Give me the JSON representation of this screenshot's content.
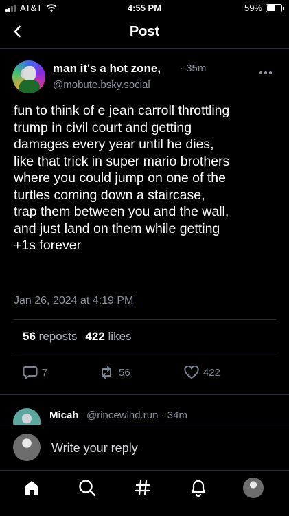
{
  "status_bar": {
    "carrier": "AT&T",
    "time": "4:55 PM",
    "battery": "59%",
    "battery_level": 0.59
  },
  "header": {
    "title": "Post",
    "back_icon": "chevron-left-icon"
  },
  "post": {
    "author_name": "man it's a hot zone,",
    "age": "· 35m",
    "handle": "@mobute.bsky.social",
    "text_lines": [
      "fun to think of e jean carroll throttling",
      "trump in civil court and getting",
      "damages every year until he dies,",
      "like that trick in super mario brothers",
      "where you could jump on one of the",
      "turtles coming down a staircase,",
      "trap them between you and the wall,",
      "and just land on them while getting",
      "+1s forever"
    ],
    "date": "Jan 26, 2024 at 4:19 PM",
    "reposts_count": "56",
    "reposts_label": "reposts",
    "likes_count": "422",
    "likes_label": "likes",
    "actions": {
      "replies": "7",
      "reposts": "56",
      "likes": "422"
    }
  },
  "reply_preview": {
    "name": "Micah",
    "handle": "@rincewind.run · 34m"
  },
  "composer": {
    "placeholder": "Write your reply"
  },
  "tabs": [
    "home-icon",
    "search-icon",
    "hashtag-icon",
    "notifications-icon",
    "profile-avatar"
  ],
  "colors": {
    "background": "#000000",
    "muted": "#8a93a0",
    "divider": "#2a2f36",
    "action": "#7a8594"
  }
}
